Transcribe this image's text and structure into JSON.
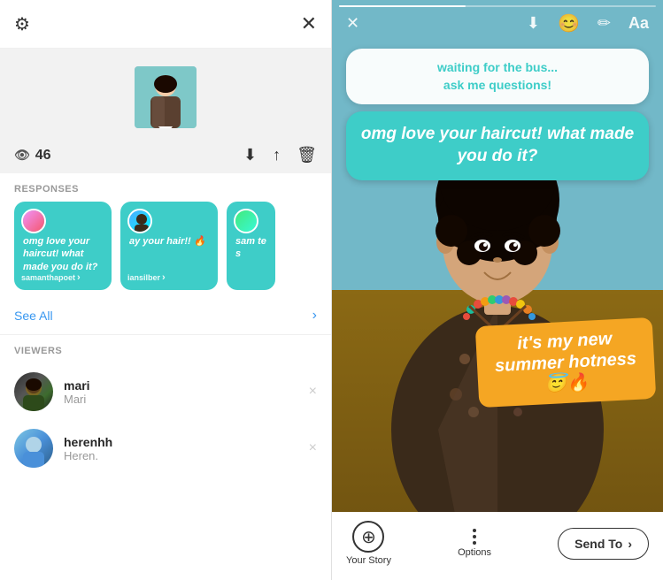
{
  "leftPanel": {
    "gearLabel": "⚙",
    "closeLabel": "✕",
    "viewCount": "46",
    "sections": {
      "responses": "RESPONSES",
      "viewers": "VIEWERS"
    },
    "seeAll": "See All",
    "downloadIcon": "⬇",
    "shareIcon": "↑",
    "deleteIcon": "🗑",
    "responsesCards": [
      {
        "text": "omg love your haircut! what made you do it?",
        "username": "samanthapoet"
      },
      {
        "text": "ay your hair!! 🔥",
        "username": "iansilber"
      },
      {
        "text": "sam te s",
        "username": ""
      }
    ],
    "viewers": [
      {
        "name": "mari",
        "handle": "Mari"
      },
      {
        "name": "herenhh",
        "handle": "Heren."
      }
    ]
  },
  "rightPanel": {
    "closeIcon": "✕",
    "downloadIcon": "⬇",
    "stickerIcon": "☺",
    "drawIcon": "✏",
    "textIcon": "Aa",
    "questionBubble": "waiting for the bus...\nask me questions!",
    "responseBubble": "omg love your haircut! what made you do it?",
    "bottomSticker": "it's my new summer hotness 😇🔥",
    "bottomActions": {
      "addStory": "Your Story",
      "options": "Options",
      "sendTo": "Send To"
    }
  }
}
